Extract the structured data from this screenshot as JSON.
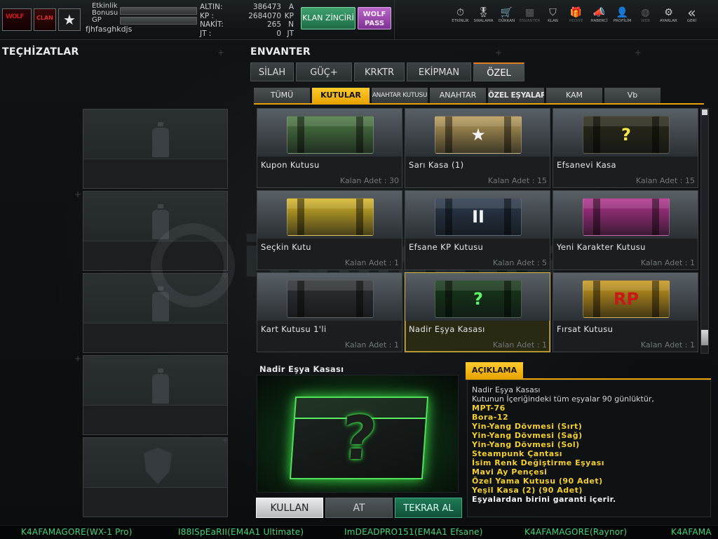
{
  "header": {
    "bonus_label": "Etkinlik\nBonusu",
    "gp_label": "GP",
    "username": "fjhfasghkdjs",
    "stats": [
      {
        "label": "ALTIN:",
        "value": "386473",
        "unit": "A"
      },
      {
        "label": "KP  :",
        "value": "2684070",
        "unit": "KP"
      },
      {
        "label": "NAKİT:",
        "value": "265",
        "unit": "N"
      },
      {
        "label": "JT   :",
        "value": "0",
        "unit": "JT"
      }
    ],
    "klan_button": "KLAN ZİNCİRİ",
    "wolf_button": "WOLF PASS",
    "nav": [
      {
        "label": "ETKİNLİK",
        "icon": "stopwatch-icon",
        "glyph": "⏱"
      },
      {
        "label": "SIRALAMA",
        "icon": "medal-icon",
        "glyph": "🎖"
      },
      {
        "label": "DÜKKAN",
        "icon": "cart-icon",
        "glyph": "🛒"
      },
      {
        "label": "ENVANTER",
        "icon": "inventory-icon",
        "glyph": "▦"
      },
      {
        "label": "KLAN",
        "icon": "clan-shield-icon",
        "glyph": "⛉"
      },
      {
        "label": "HEDİYE",
        "icon": "gift-icon",
        "glyph": "🎁"
      },
      {
        "label": "HABERCİ",
        "icon": "megaphone-icon",
        "glyph": "📣"
      },
      {
        "label": "PROFİLİM",
        "icon": "profile-icon",
        "glyph": "👤"
      },
      {
        "label": "WEB",
        "icon": "globe-icon",
        "glyph": "◍"
      },
      {
        "label": "AYARLAR",
        "icon": "gear-icon",
        "glyph": "⚙"
      },
      {
        "label": "GERİ",
        "icon": "back-chevron-icon",
        "glyph": "«"
      }
    ]
  },
  "left": {
    "title": "TEÇHİZATLAR"
  },
  "inventory": {
    "title": "ENVANTER",
    "main_tabs": [
      "SİLAH",
      "GÜÇ+",
      "KRKTR",
      "EKİPMAN",
      "ÖZEL"
    ],
    "active_main_tab": "ÖZEL",
    "sub_tabs": [
      "TÜMÜ",
      "KUTULAR",
      "ANAHTAR KUTUSU",
      "ANAHTAR",
      "ÖZEL EŞYALAR",
      "KAM",
      "Vb"
    ],
    "active_sub_tab": "KUTULAR",
    "items": [
      {
        "name": "Kupon Kutusu",
        "count": "Kalan Adet : 30",
        "color": "#4e7a45",
        "mark": ""
      },
      {
        "name": "Sarı Kasa (1)",
        "count": "Kalan Adet : 15",
        "color": "#b89c5a",
        "mark": "★"
      },
      {
        "name": "Efsanevi Kasa",
        "count": "Kalan Adet : 15",
        "color": "#2b2a1a",
        "mark": "?"
      },
      {
        "name": "Seçkin Kutu",
        "count": "Kalan Adet : 1",
        "color": "#d6b62a",
        "mark": ""
      },
      {
        "name": "Efsane KP Kutusu",
        "count": "Kalan Adet : 5",
        "color": "#2c3a4e",
        "mark": "II"
      },
      {
        "name": "Yeni Karakter Kutusu",
        "count": "Kalan Adet : 1",
        "color": "#b1338d",
        "mark": ""
      },
      {
        "name": "Kart Kutusu 1'li",
        "count": "Kalan Adet : 1",
        "color": "#2d3236",
        "mark": ""
      },
      {
        "name": "Nadir Eşya Kasası",
        "count": "Kalan Adet : 1",
        "color": "#173a1a",
        "mark": "?"
      },
      {
        "name": "Fırsat Kutusu",
        "count": "Kalan Adet : 1",
        "color": "#c99a1e",
        "mark": "RP"
      }
    ]
  },
  "detail": {
    "title": "Nadir Eşya Kasası",
    "buttons": {
      "use": "KULLAN",
      "drop": "AT",
      "rebuy": "TEKRAR AL"
    },
    "desc_tab": "AÇIKLAMA",
    "desc_lines": [
      "Nadir Eşya Kasası",
      "Kutunun İçeriğindeki tüm eşyalar 90 günlüktür,"
    ],
    "desc_items": [
      "MPT-76",
      "Bora-12",
      "Yin-Yang Dövmesi (Sırt)",
      "Yin-Yang Dövmesi (Sağ)",
      "Yin-Yang Dövmesi (Sol)",
      "Steampunk Çantası",
      "İsim Renk Değiştirme Eşyası",
      "Mavi Ay Pençesi",
      "Özel Yama Kutusu (90 Adet)",
      "Yeşil Kasa (2) (90 Adet)"
    ],
    "desc_footer": "Eşyalardan birini garanti içerir."
  },
  "ticker": [
    "K4AFAMAGORE(WX-1 Pro)",
    "I88ISpEaRII(EM4A1 Ultimate)",
    "ImDEADPRO151(EM4A1 Efsane)",
    "K4AFAMAGORE(Raynor)",
    "K4AFAMA"
  ],
  "watermark": "itemsatış"
}
